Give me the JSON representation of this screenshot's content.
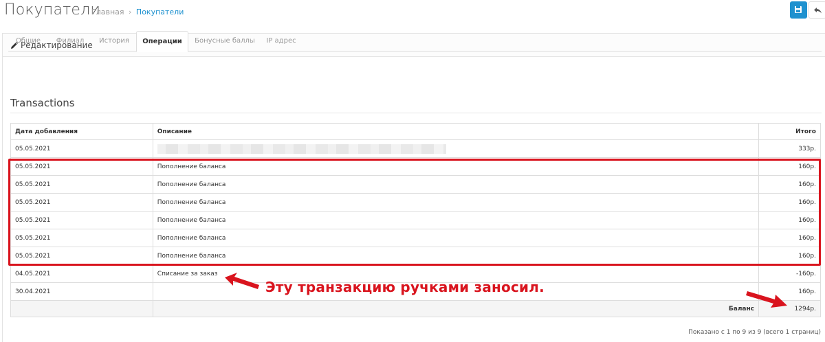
{
  "header": {
    "title": "Покупатели",
    "breadcrumb": {
      "home": "Главная",
      "separator": "›",
      "current": "Покупатели"
    }
  },
  "panel": {
    "title": "Редактирование"
  },
  "tabs": [
    {
      "label": "Общие"
    },
    {
      "label": "Филиал"
    },
    {
      "label": "История"
    },
    {
      "label": "Операции",
      "active": true
    },
    {
      "label": "Бонусные баллы"
    },
    {
      "label": "IP адрес"
    }
  ],
  "section": {
    "title": "Transactions"
  },
  "table": {
    "columns": {
      "date": "Дата добавления",
      "description": "Описание",
      "total": "Итого"
    },
    "rows": [
      {
        "date": "05.05.2021",
        "description": "",
        "total": "333р."
      },
      {
        "date": "05.05.2021",
        "description": "Пополнение баланса",
        "total": "160р."
      },
      {
        "date": "05.05.2021",
        "description": "Пополнение баланса",
        "total": "160р."
      },
      {
        "date": "05.05.2021",
        "description": "Пополнение баланса",
        "total": "160р."
      },
      {
        "date": "05.05.2021",
        "description": "Пополнение баланса",
        "total": "160р."
      },
      {
        "date": "05.05.2021",
        "description": "Пополнение баланса",
        "total": "160р."
      },
      {
        "date": "05.05.2021",
        "description": "Пополнение баланса",
        "total": "160р."
      },
      {
        "date": "04.05.2021",
        "description": "Списание за заказ",
        "total": "-160р."
      },
      {
        "date": "30.04.2021",
        "description": "",
        "total": "160р."
      }
    ],
    "footer": {
      "label": "Баланс",
      "value": "1294р."
    }
  },
  "annotation": {
    "text": "Эту транзакцию ручками заносил.",
    "color": "#d9141e"
  },
  "pagination": {
    "text": "Показано с 1 по 9 из 9 (всего 1 страниц)"
  },
  "colors": {
    "primary": "#1e91cf",
    "highlight": "#d9141e"
  },
  "icons": {
    "save": "save-icon",
    "back": "reply-icon",
    "edit": "pencil-icon"
  }
}
